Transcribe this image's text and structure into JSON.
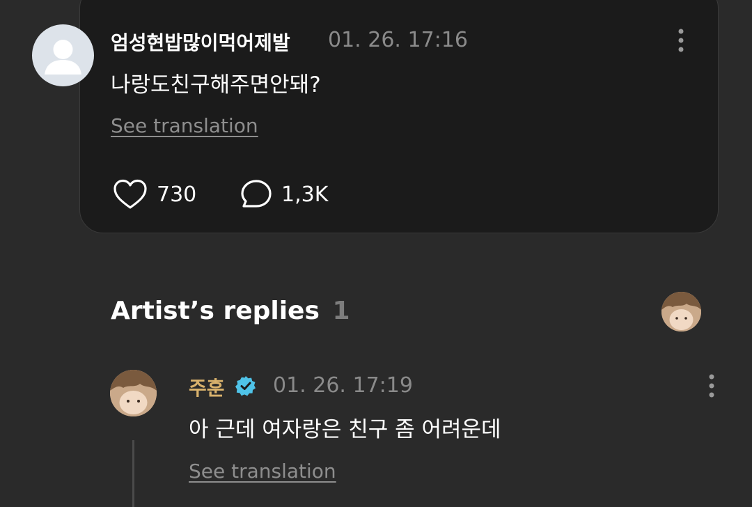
{
  "comment": {
    "author": "엄성현밥많이먹어제발",
    "timestamp": "01. 26. 17:16",
    "text": "나랑도친구해주면안돼?",
    "see_translation": "See translation",
    "likes": "730",
    "replies": "1,3K",
    "icons": {
      "avatar": "default-user-avatar",
      "menu": "more-vertical-icon",
      "like": "heart-outline-icon",
      "reply": "speech-bubble-outline-icon"
    }
  },
  "artist_replies": {
    "heading": "Artist’s replies",
    "count": "1",
    "reply": {
      "author": "주훈",
      "timestamp": "01. 26. 17:19",
      "text": "아 근데 여자랑은 친구 좀 어려운데",
      "see_translation": "See translation",
      "icons": {
        "verified": "verified-badge-icon",
        "menu": "more-vertical-icon"
      }
    }
  },
  "colors": {
    "background": "#2a2a2a",
    "card_background": "#1b1b1b",
    "artist_name": "#d9b26c",
    "verified_badge": "#4fc3e8",
    "muted_text": "#8a8a8a"
  }
}
